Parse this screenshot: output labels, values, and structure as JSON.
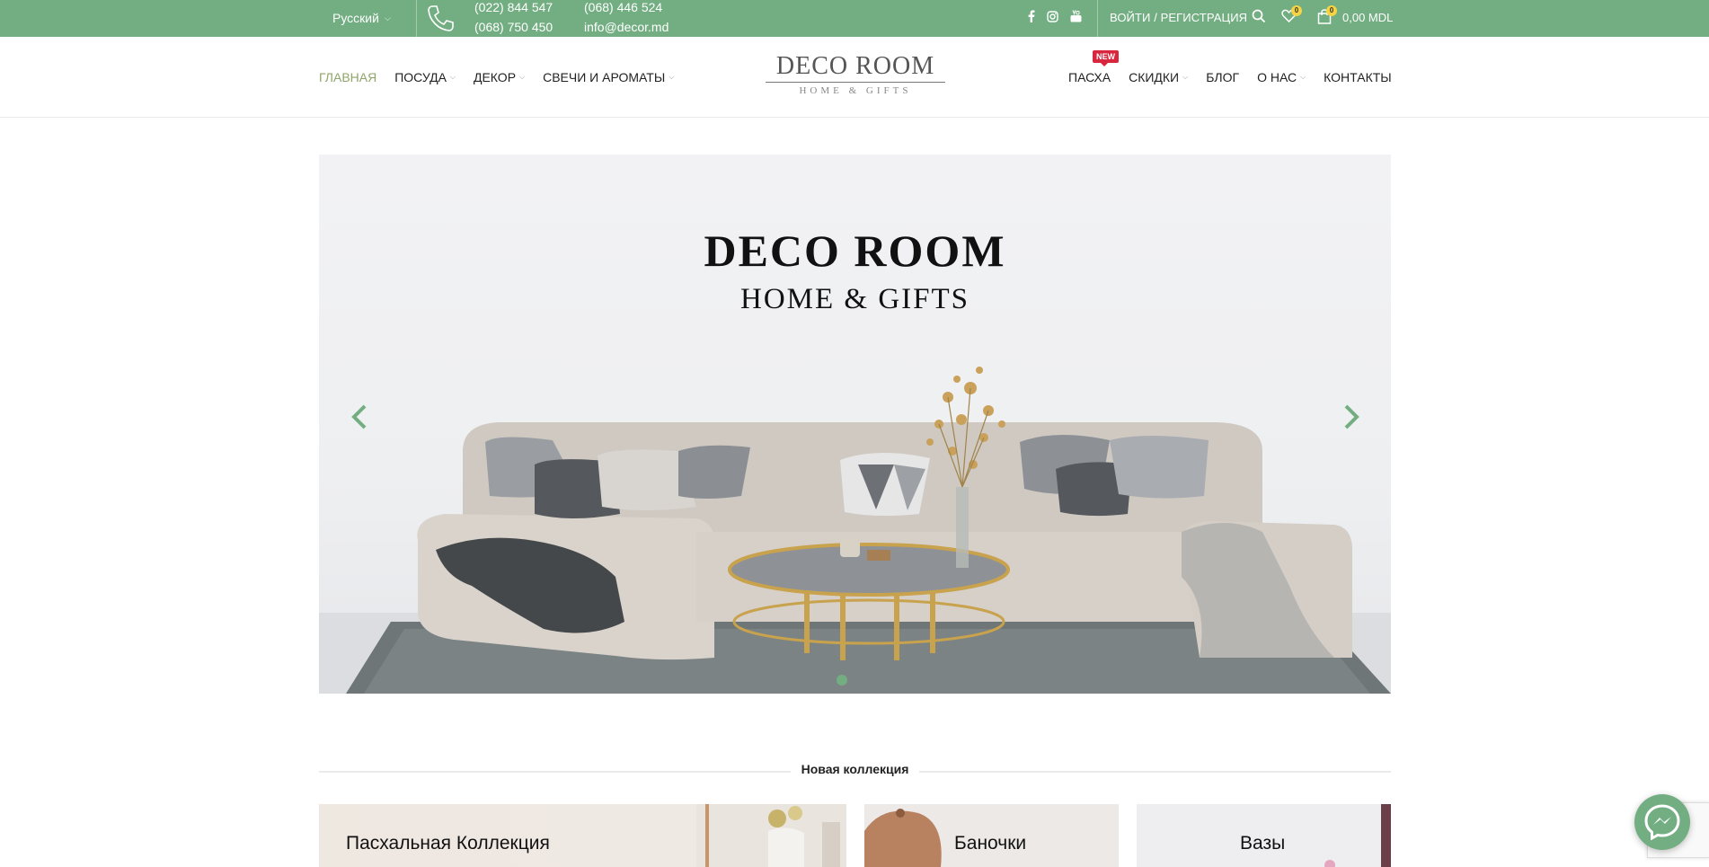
{
  "topbar": {
    "language": "Русский",
    "phones_col1": [
      "(022) 844 547",
      "(068) 750 450"
    ],
    "phones_col2": [
      "(068) 446 524",
      "info@decor.md"
    ],
    "socials": [
      "facebook-icon",
      "instagram-icon",
      "youtube-icon"
    ],
    "login_label": "ВОЙТИ / РЕГИСТРАЦИЯ",
    "wishlist_count": "0",
    "cart_count": "0",
    "cart_total": "0,00 MDL"
  },
  "nav_left": [
    {
      "label": "ГЛАВНАЯ",
      "active": true,
      "dropdown": false
    },
    {
      "label": "ПОСУДА",
      "dropdown": true
    },
    {
      "label": "ДЕКОР",
      "dropdown": true
    },
    {
      "label": "СВЕЧИ И АРОМАТЫ",
      "dropdown": true
    }
  ],
  "logo": {
    "line1": "DECO ROOM",
    "line2": "HOME & GIFTS"
  },
  "nav_right": [
    {
      "label": "ПАСХА",
      "tag": "NEW",
      "dropdown": false
    },
    {
      "label": "СКИДКИ",
      "dropdown": true
    },
    {
      "label": "БЛОГ",
      "dropdown": false
    },
    {
      "label": "О НАС",
      "dropdown": true
    },
    {
      "label": "КОНТАКТЫ",
      "dropdown": false
    }
  ],
  "hero": {
    "title": "DECO ROOM",
    "subtitle": "HOME & GIFTS",
    "slides_count": 1,
    "active_slide": 1
  },
  "section": {
    "title": "Новая коллекция"
  },
  "collections": [
    {
      "label": "Пасхальная Коллекция"
    },
    {
      "label": "Баночки"
    },
    {
      "label": "Вазы"
    }
  ],
  "colors": {
    "accent": "#72ae82",
    "active_nav": "#8ea66a",
    "new_tag": "#d7263d",
    "badge": "#f5d342"
  }
}
